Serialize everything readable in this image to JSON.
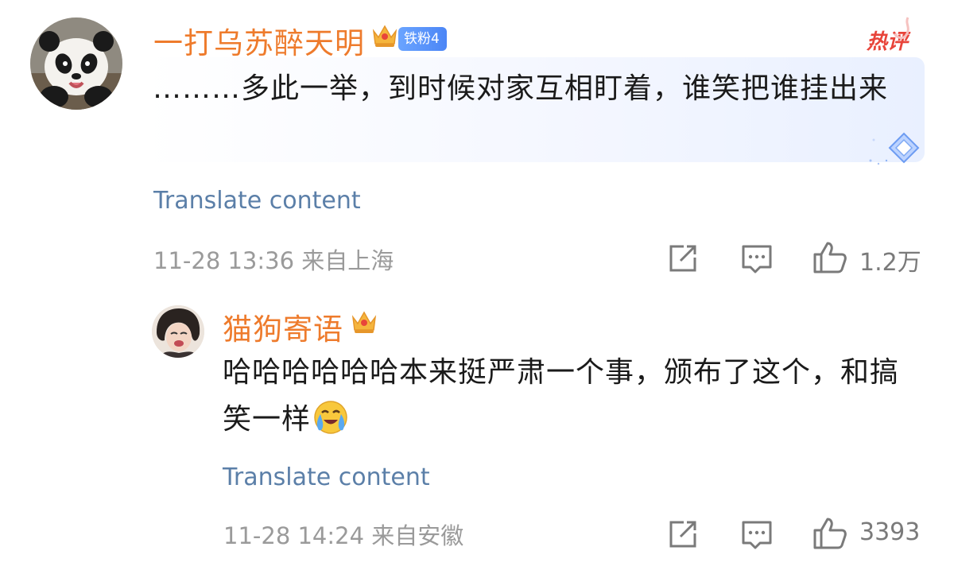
{
  "comment": {
    "username": "一打乌苏醉天明",
    "fan_badge": "铁粉4",
    "hot_label": "热评",
    "text": "………多此一举，到时候对家互相盯着，谁笑把谁挂出来",
    "translate": "Translate content",
    "time": "11-28 13:36",
    "location": "来自上海",
    "likes": "1.2万"
  },
  "reply": {
    "username": "猫狗寄语",
    "text": "哈哈哈哈哈哈本来挺严肃一个事，颁布了这个，和搞笑一样",
    "emoji_icon": "crying-laughing-emoji-icon",
    "translate": "Translate content",
    "time": "11-28 14:24",
    "location": "来自安徽",
    "likes": "3393"
  },
  "icons": {
    "share": "share-icon",
    "comment": "comment-icon",
    "like": "like-icon",
    "crown": "crown-icon",
    "diamond": "diamond-badge-icon"
  },
  "colors": {
    "username": "#ee7b2c",
    "translate": "#5b7fa8",
    "meta": "#9a9a9a",
    "hot": "#e8443a",
    "badge": "#4c86f6"
  }
}
